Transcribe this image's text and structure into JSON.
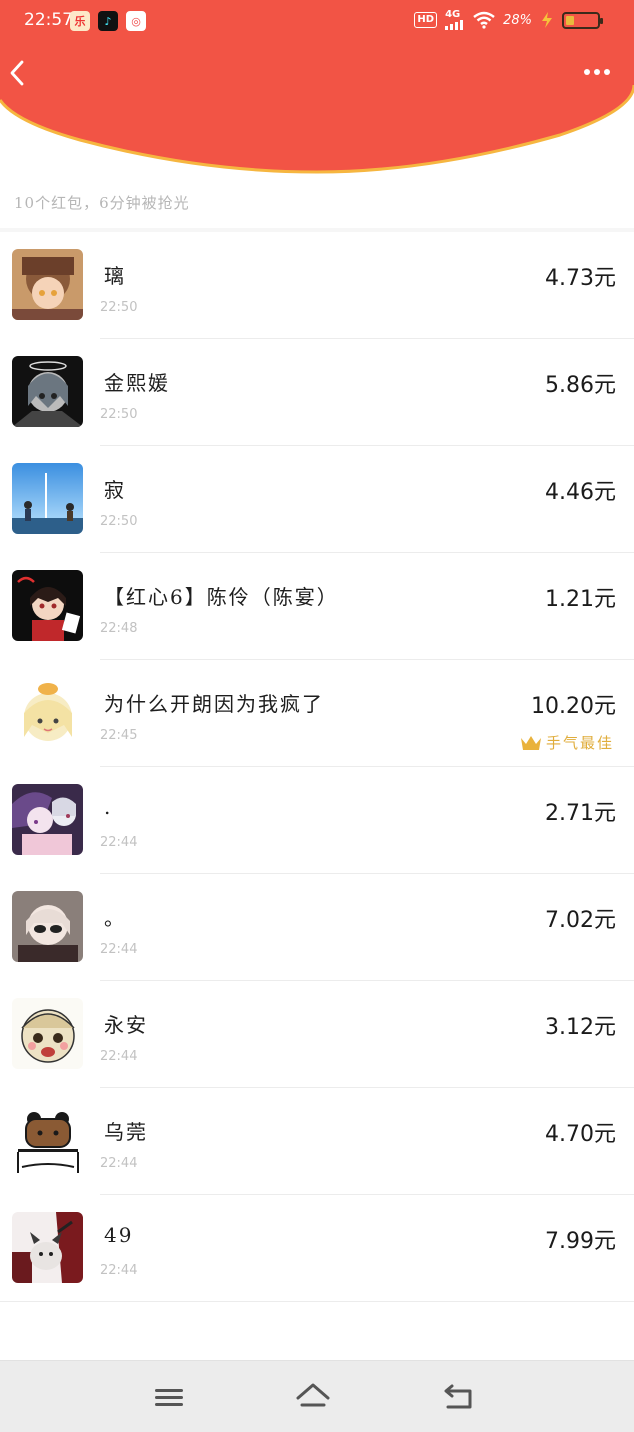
{
  "status_bar": {
    "time": "22:57",
    "network_badge": "HD",
    "network_type": "4G",
    "battery_percent": "28%",
    "battery_level": 0.28
  },
  "header": {
    "color": "#f25445",
    "back_icon": "chevron-left-icon",
    "more_icon": "more-dots-icon"
  },
  "summary": {
    "text": "10个红包，6分钟被抢光"
  },
  "records": [
    {
      "name": "璃",
      "time": "22:50",
      "amount": "4.73元"
    },
    {
      "name": "金熙媛",
      "time": "22:50",
      "amount": "5.86元"
    },
    {
      "name": "寂",
      "time": "22:50",
      "amount": "4.46元"
    },
    {
      "name": "【红心6】陈伶（陈宴）",
      "time": "22:48",
      "amount": "1.21元"
    },
    {
      "name": "为什么开朗因为我疯了",
      "time": "22:45",
      "amount": "10.20元",
      "best_label": "手气最佳"
    },
    {
      "name": ".",
      "time": "22:44",
      "amount": "2.71元"
    },
    {
      "name": "。",
      "time": "22:44",
      "amount": "7.02元"
    },
    {
      "name": "永安",
      "time": "22:44",
      "amount": "3.12元"
    },
    {
      "name": "乌莞",
      "time": "22:44",
      "amount": "4.70元"
    },
    {
      "name": "49",
      "time": "22:44",
      "amount": "7.99元"
    }
  ],
  "nav_bar": {
    "menu_icon": "menu-icon",
    "home_icon": "home-icon",
    "back_icon": "back-icon"
  }
}
